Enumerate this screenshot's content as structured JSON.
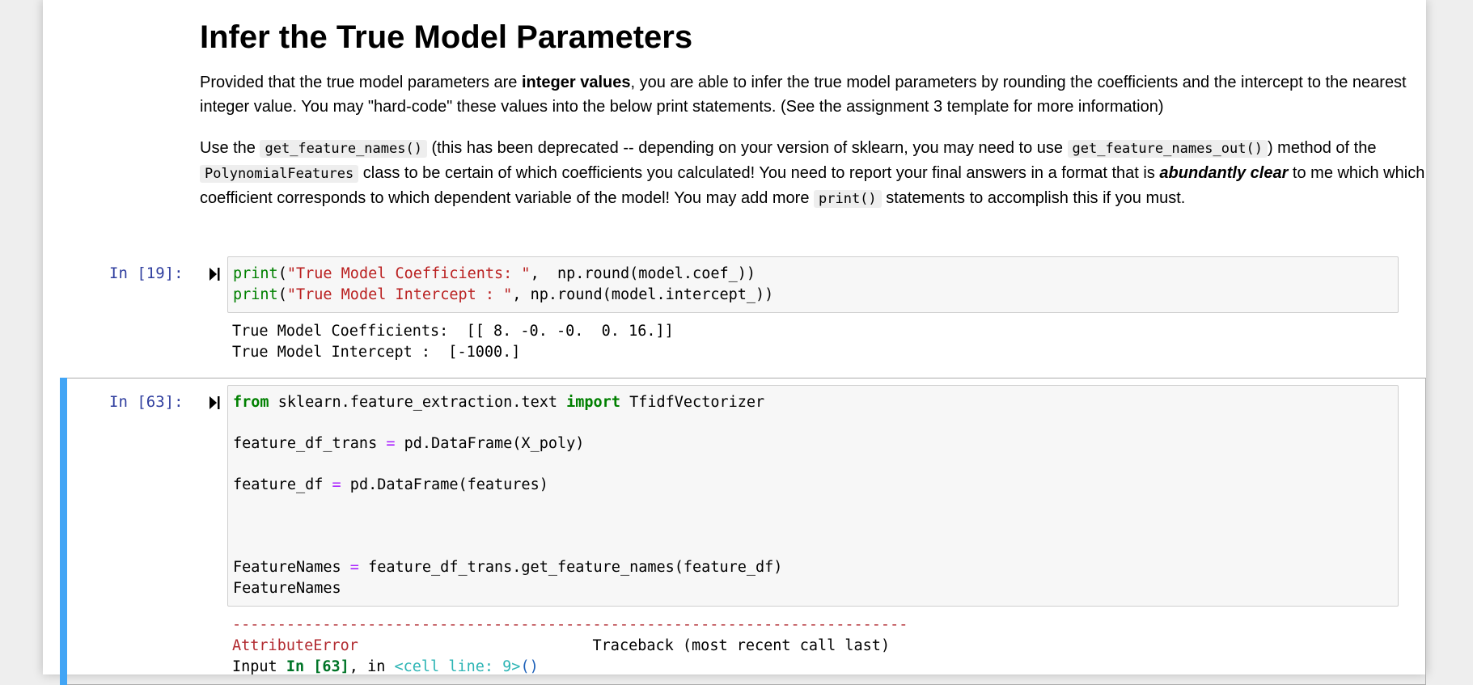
{
  "markdown": {
    "title": "Infer the True Model Parameters",
    "para1": {
      "t1": "Provided that the true model parameters are ",
      "bold": "integer values",
      "t2": ", you are able to infer the true model parameters by rounding the coefficients and the intercept to the nearest integer value. You may \"hard-code\" these values into the below print statements. (See the assignment 3 template for more information)"
    },
    "para2": {
      "t1": "Use the ",
      "c1": "get_feature_names()",
      "t2": " (this has been deprecated -- depending on your version of sklearn, you may need to use ",
      "c2": "get_feature_names_out()",
      "t3": ") method of the ",
      "c3": "PolynomialFeatures",
      "t4": " class to be certain of which coefficients you calculated! You need to report your final answers in a format that is ",
      "bi": "abundantly clear",
      "t5": " to me which which coefficient corresponds to which dependent variable of the model! You may add more ",
      "c4": "print()",
      "t6": " statements to accomplish this if you must."
    }
  },
  "cell19": {
    "prompt": "In [19]:",
    "code": {
      "l1_fn": "print",
      "l1_str": "\"True Model Coefficients: \"",
      "l1_rest": ",  np.round(model.coef_))",
      "l2_fn": "print",
      "l2_str": "\"True Model Intercept : \"",
      "l2_rest": ", np.round(model.intercept_))"
    },
    "output": {
      "line1": "True Model Coefficients:  [[ 8. -0. -0.  0. 16.]]",
      "line2": "True Model Intercept :  [-1000.]"
    }
  },
  "cell63": {
    "prompt": "In [63]:",
    "code": {
      "l1_from": "from",
      "l1_mod": " sklearn.feature_extraction.text ",
      "l1_import": "import",
      "l1_name": " TfidfVectorizer",
      "l3_var": "feature_df_trans ",
      "l3_op": "=",
      "l3_rest": " pd.DataFrame(X_poly)",
      "l5_var": "feature_df ",
      "l5_op": "=",
      "l5_rest": " pd.DataFrame(features)",
      "l9_var": "FeatureNames ",
      "l9_op": "=",
      "l9_rest": " feature_df_trans.get_feature_names(feature_df)",
      "l10": "FeatureNames"
    },
    "error": {
      "dashes": "---------------------------------------------------------------------------",
      "name": "AttributeError",
      "traceback_pad": "                          ",
      "traceback": "Traceback (most recent call last)",
      "input_label": "Input ",
      "input_ref": "In [63]",
      "input_mid": ", in ",
      "cell_line": "<cell line: 9>",
      "parens": "()"
    }
  },
  "colors": {
    "prompt": "#303f9f",
    "selected_bar": "#42a5f5",
    "keyword": "#008000",
    "string": "#ba2121",
    "operator": "#aa22ff"
  }
}
